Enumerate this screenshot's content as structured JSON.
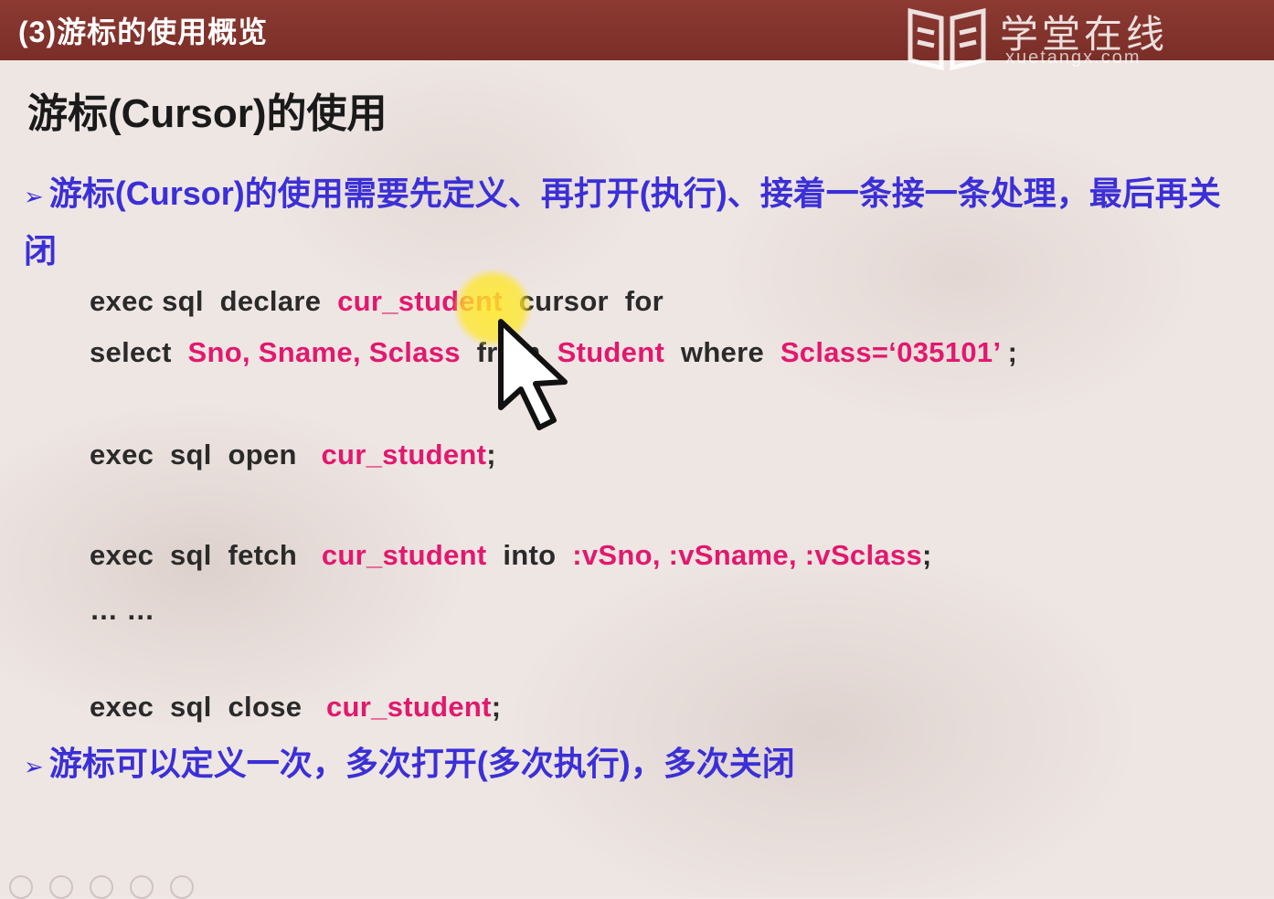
{
  "header": {
    "title": "(3)游标的使用概览",
    "logo_cn": "学堂在线",
    "logo_en": "xuetangx.com"
  },
  "slide": {
    "title": "游标(Cursor)的使用",
    "bullet1": "游标(Cursor)的使用需要先定义、再打开(执行)、接着一条接一条处理，最后再关闭",
    "bullet2": "游标可以定义一次，多次打开(多次执行)，多次关闭",
    "code": {
      "line1": {
        "a": "exec sql  declare  ",
        "b": "cur_student",
        "c": "  cursor  for"
      },
      "line2": {
        "a": "select  ",
        "b": "Sno, Sname, Sclass",
        "c": "  from  ",
        "d": "Student",
        "e": "  where  ",
        "f": "Sclass=‘035101’",
        "g": " ;"
      },
      "line3": {
        "a": "exec  sql  open   ",
        "b": "cur_student",
        "c": ";"
      },
      "line4": {
        "a": "exec  sql  fetch   ",
        "b": "cur_student",
        "c": "  into  ",
        "d": ":vSno, :vSname, :vSclass",
        "e": ";"
      },
      "line5": "… …",
      "line6": {
        "a": "exec  sql  close   ",
        "b": "cur_student",
        "c": ";"
      }
    }
  },
  "colors": {
    "header_bg": "#7a2e27",
    "bullet_text": "#3b2fd8",
    "code_highlight": "#e2186e",
    "code_text": "#2a2a2a"
  },
  "icons": [
    "xuetangx-logo-icon",
    "mouse-cursor-icon",
    "bullet-arrow-icon"
  ]
}
